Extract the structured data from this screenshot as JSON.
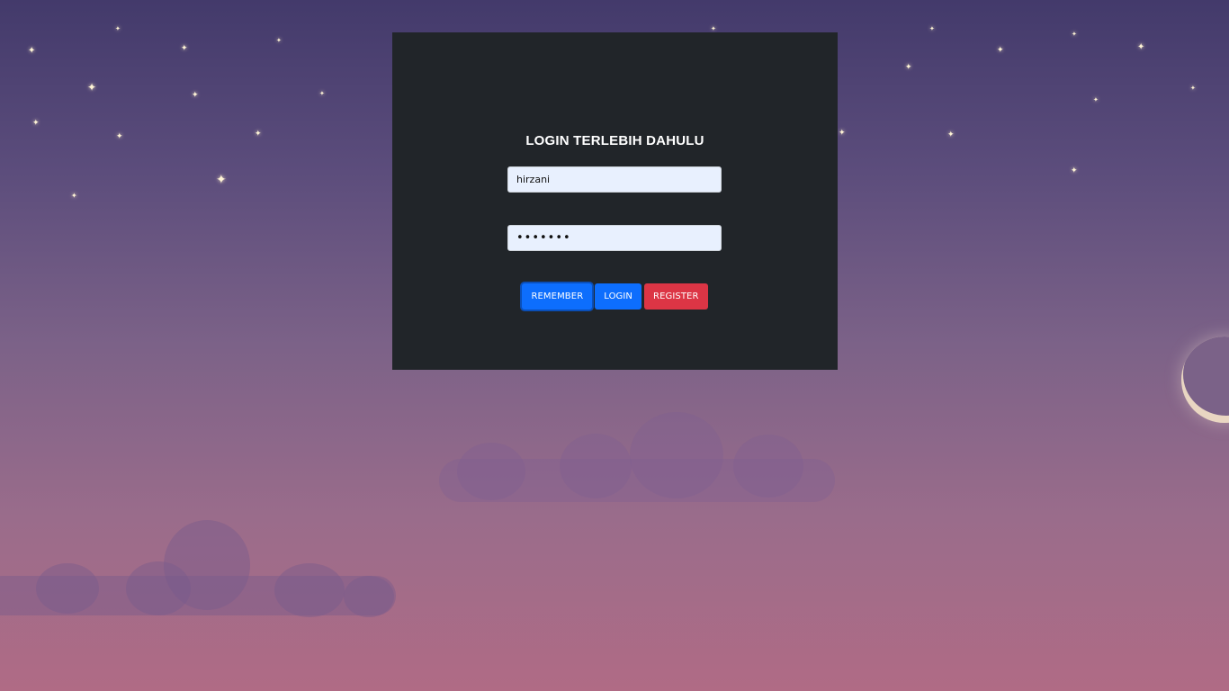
{
  "login": {
    "title": "LOGIN TERLEBIH DAHULU",
    "username_value": "hirzani",
    "password_value": "1234567",
    "remember_label": "REMEMBER",
    "login_label": "LOGIN",
    "register_label": "REGISTER"
  },
  "colors": {
    "card_bg": "#212529",
    "primary": "#0d6efd",
    "danger": "#dc3545",
    "input_bg": "#e8f0fe",
    "sky_top": "#433a6b",
    "sky_bottom": "#b06b85"
  },
  "icons": [
    "star-icon",
    "moon-icon",
    "cloud-shape"
  ]
}
